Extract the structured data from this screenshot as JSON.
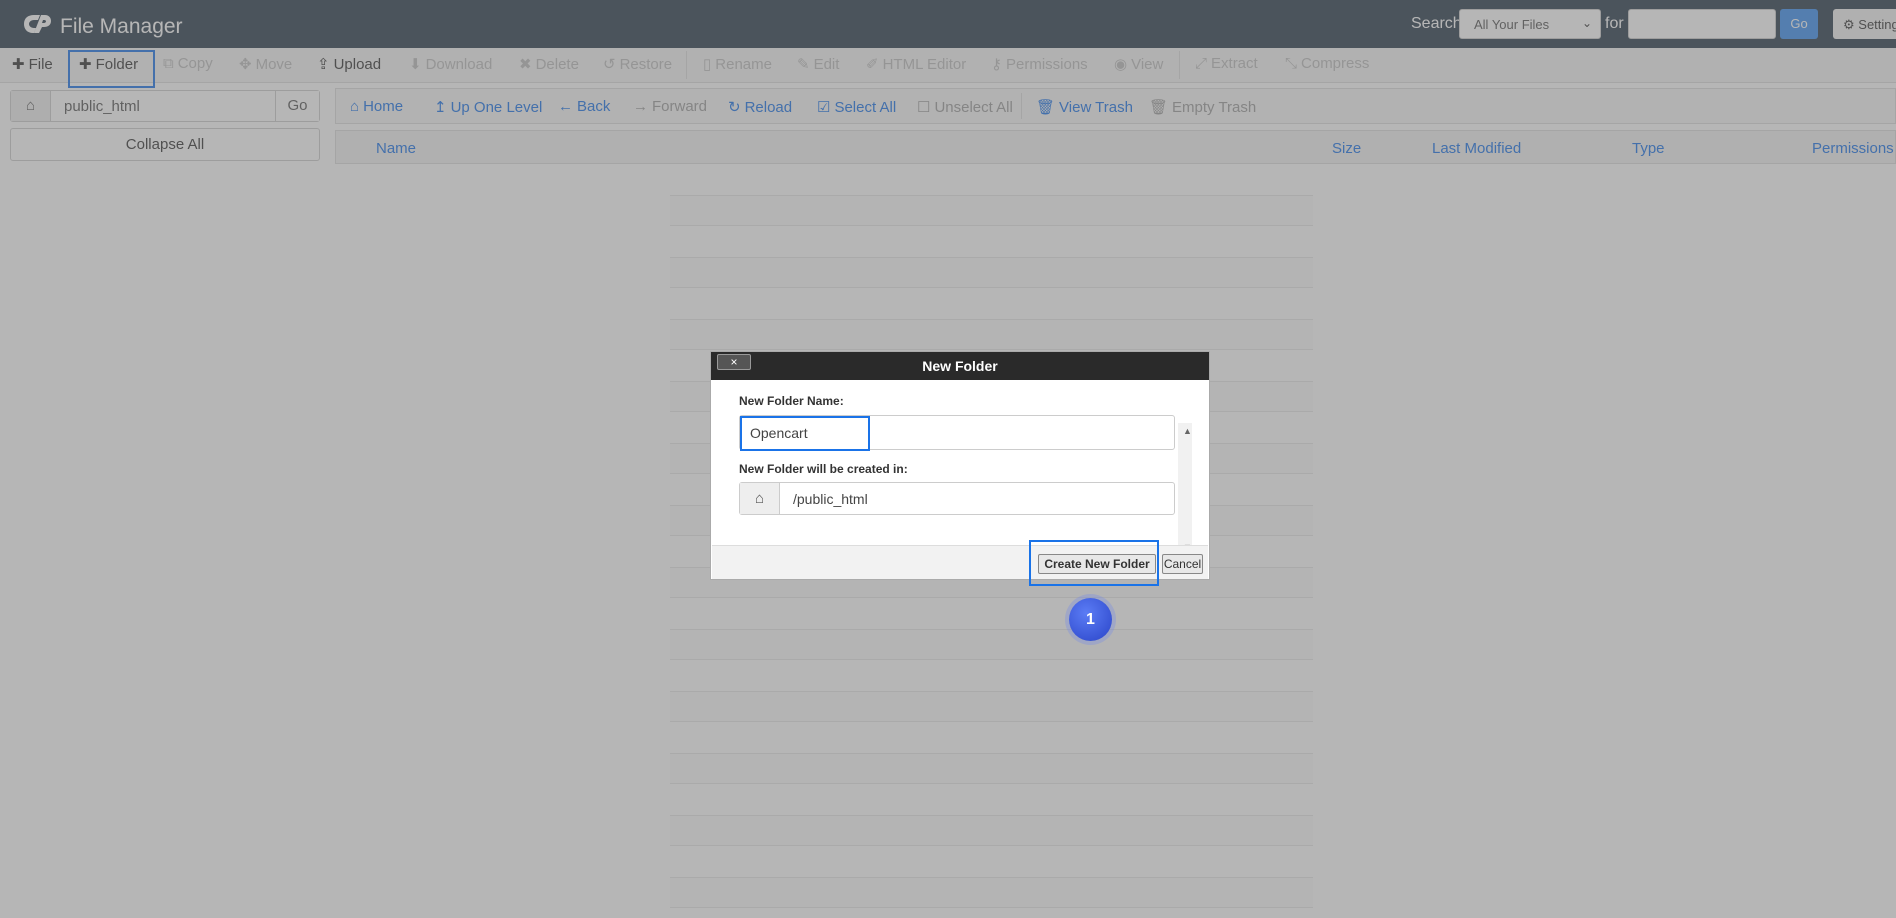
{
  "header": {
    "app_title": "File Manager",
    "search_label": "Search",
    "search_scope": "All Your Files",
    "for_label": "for",
    "search_value": "",
    "go_label": "Go",
    "settings_label": "Settings"
  },
  "toolbar": {
    "file": "File",
    "folder": "Folder",
    "copy": "Copy",
    "move": "Move",
    "upload": "Upload",
    "download": "Download",
    "delete": "Delete",
    "restore": "Restore",
    "rename": "Rename",
    "edit": "Edit",
    "html_editor": "HTML Editor",
    "permissions": "Permissions",
    "view": "View",
    "extract": "Extract",
    "compress": "Compress"
  },
  "sidebar": {
    "path_value": "public_html",
    "go_label": "Go",
    "collapse_label": "Collapse All"
  },
  "nav": {
    "home": "Home",
    "up_one_level": "Up One Level",
    "back": "Back",
    "forward": "Forward",
    "reload": "Reload",
    "select_all": "Select All",
    "unselect_all": "Unselect All",
    "view_trash": "View Trash",
    "empty_trash": "Empty Trash"
  },
  "table": {
    "columns": [
      "Name",
      "Size",
      "Last Modified",
      "Type",
      "Permissions"
    ]
  },
  "dialog": {
    "title": "New Folder",
    "close_label": "×",
    "name_label": "New Folder Name:",
    "name_value": "Opencart",
    "location_label": "New Folder will be created in:",
    "location_value": "/public_html",
    "create_label": "Create New Folder",
    "cancel_label": "Cancel"
  },
  "step_marker": "1",
  "colors": {
    "header_bg": "#293a4a",
    "accent": "#1a73e8",
    "dialog_header": "#2a2a2a"
  },
  "icons": [
    "cpanel-logo",
    "plus-icon",
    "copy-icon",
    "move-icon",
    "upload-icon",
    "download-icon",
    "delete-icon",
    "restore-icon",
    "rename-icon",
    "edit-icon",
    "html-editor-icon",
    "permissions-icon",
    "view-icon",
    "extract-icon",
    "compress-icon",
    "home-icon",
    "up-icon",
    "back-icon",
    "forward-icon",
    "reload-icon",
    "checkbox-checked-icon",
    "checkbox-empty-icon",
    "trash-icon",
    "gear-icon",
    "chevron-down-icon",
    "close-icon"
  ]
}
